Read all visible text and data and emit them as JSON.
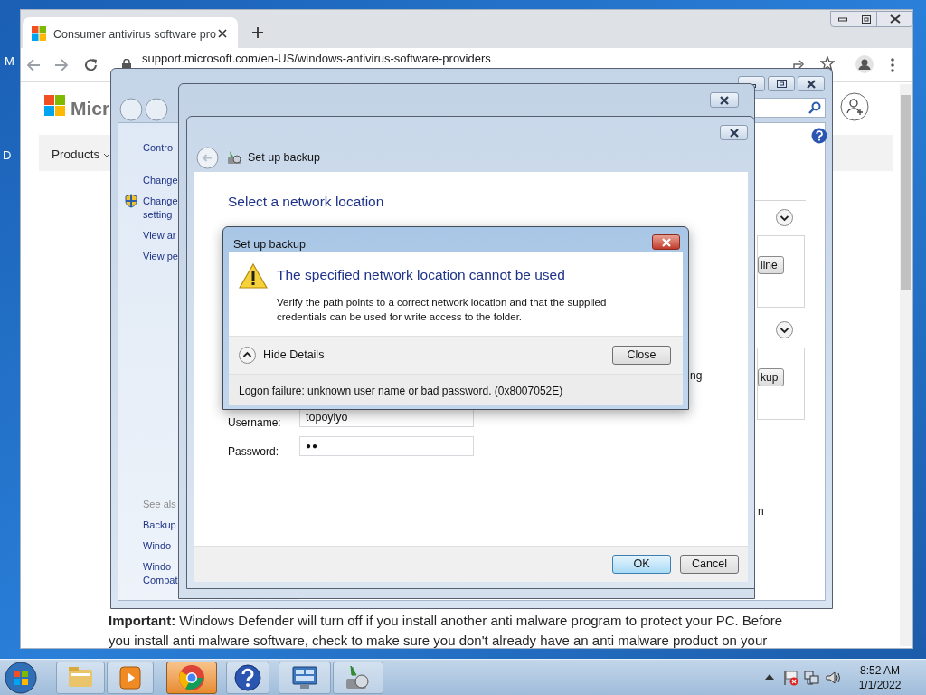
{
  "desktop": {
    "icon_labels": [
      "M",
      "D"
    ]
  },
  "browser": {
    "tab": {
      "title": "Consumer antivirus software pro"
    },
    "url": "support.microsoft.com/en-US/windows-antivirus-software-providers",
    "page": {
      "logo_text": "Micr",
      "nav": [
        "Products"
      ],
      "note_lines": [
        "**Important:** Windows Defender will turn off if you install another anti malware program to protect your PC. Before",
        "you install anti malware software, check to make sure you don't already have an anti malware product on your"
      ]
    }
  },
  "control_panel": {
    "sidebar": [
      {
        "lines": [
          "Contro"
        ],
        "kind": "heading"
      },
      {
        "lines": [
          "Change"
        ],
        "kind": "link"
      },
      {
        "lines": [
          "Change",
          "setting"
        ],
        "kind": "shield-link"
      },
      {
        "lines": [
          "View ar"
        ],
        "kind": "link"
      },
      {
        "lines": [
          "View pe"
        ],
        "kind": "link"
      },
      {
        "lines": [
          "See als"
        ],
        "kind": "caption"
      },
      {
        "lines": [
          "Backup"
        ],
        "kind": "link"
      },
      {
        "lines": [
          "Windo"
        ],
        "kind": "link"
      },
      {
        "lines": [
          "Windo",
          "Compat"
        ],
        "kind": "link"
      }
    ],
    "panels": [
      {
        "button": "line"
      },
      {
        "button": "kup"
      }
    ],
    "fragment": "n"
  },
  "backup_window": {
    "title": "Set up backup",
    "heading": "Select a network location",
    "fragment": "ng",
    "fields": [
      {
        "label": "Username:",
        "value": "topoyiyo",
        "kind": "text"
      },
      {
        "label": "Password:",
        "value": "●●",
        "kind": "password"
      }
    ],
    "buttons": [
      {
        "label": "OK",
        "default": true
      },
      {
        "label": "Cancel",
        "default": false
      }
    ]
  },
  "error_dialog": {
    "title": "Set up backup",
    "heading": "The specified network location cannot be used",
    "message": [
      "Verify the path points to a correct network location and that the supplied",
      "credentials can be used for write access to the folder."
    ],
    "details_toggle": "Hide Details",
    "expanded": true,
    "button": "Close",
    "details": "Logon failure: unknown user name or bad password. (0x8007052E)"
  },
  "taskbar": {
    "apps": [
      {
        "kind": "folder",
        "selected": false
      },
      {
        "kind": "media",
        "selected": false
      },
      {
        "kind": "chrome",
        "selected": true
      },
      {
        "kind": "help",
        "selected": false
      },
      {
        "kind": "control-panel",
        "selected": false
      },
      {
        "kind": "backup",
        "selected": false
      }
    ],
    "clock": {
      "time": "8:52 AM",
      "date": "1/1/2022"
    }
  }
}
